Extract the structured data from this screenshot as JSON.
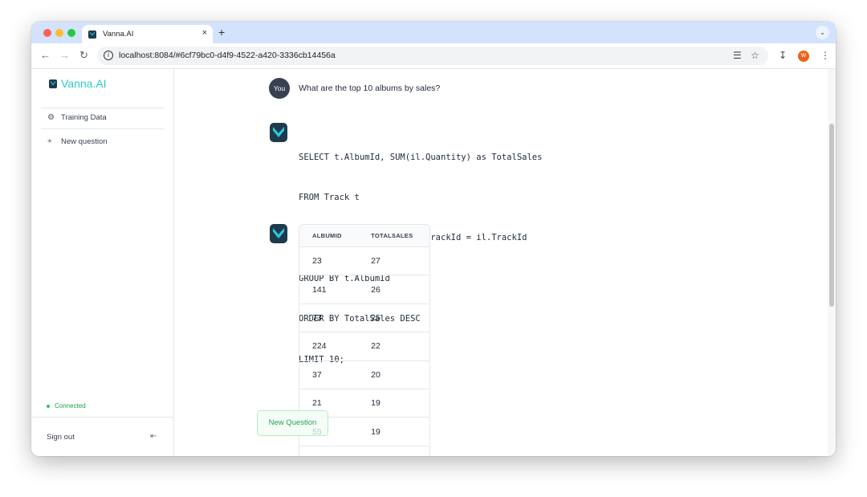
{
  "browser": {
    "tab_title": "Vanna.AI",
    "tab_close": "×",
    "new_tab": "+",
    "tab_menu": "⌄",
    "url": "localhost:8084/#6cf79bc0-d4f9-4522-a420-3336cb14456a",
    "profile_initial": "W"
  },
  "sidebar": {
    "brand": "Vanna.AI",
    "items": [
      {
        "icon": "training-data-icon",
        "label": "Training Data"
      },
      {
        "icon": "plus-icon",
        "label": "New question"
      }
    ],
    "status": "Connected",
    "sign_out": "Sign out"
  },
  "chat": {
    "user_avatar": "You",
    "question": "What are the top 10 albums by sales?",
    "sql_lines": [
      "SELECT t.AlbumId, SUM(il.Quantity) as TotalSales",
      "FROM Track t",
      "JOIN InvoiceLine il ON t.TrackId = il.TrackId",
      "GROUP BY t.AlbumId",
      "ORDER BY TotalSales DESC",
      "LIMIT 10;"
    ],
    "table": {
      "headers": [
        "ALBUMID",
        "TOTALSALES"
      ],
      "rows": [
        [
          "23",
          "27"
        ],
        [
          "141",
          "26"
        ],
        [
          "73",
          "25"
        ],
        [
          "224",
          "22"
        ],
        [
          "37",
          "20"
        ],
        [
          "21",
          "19"
        ],
        [
          "55",
          "19"
        ]
      ]
    },
    "new_question_button": "New Question"
  },
  "colors": {
    "brand": "#2fc9c2",
    "status_green": "#16a34a",
    "tab_strip": "#d3e3fd"
  }
}
